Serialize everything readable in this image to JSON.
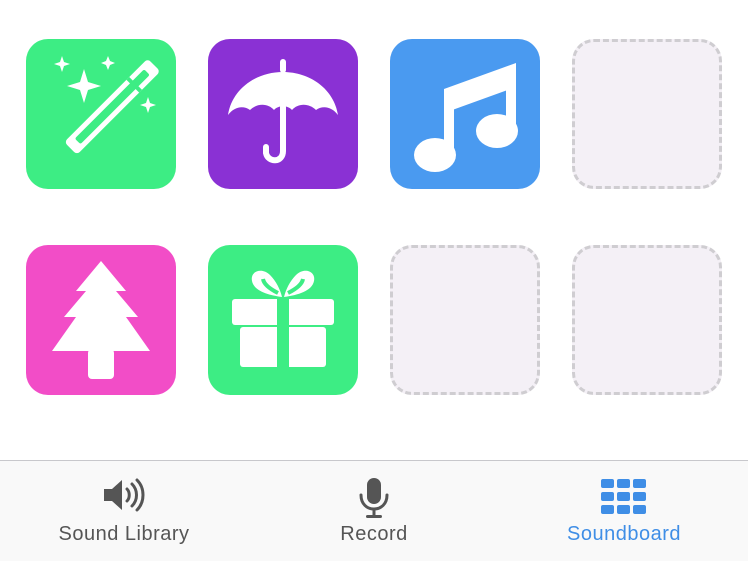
{
  "colors": {
    "tile_green": "#3ded84",
    "tile_purple": "#8a31d4",
    "tile_blue": "#4a9af0",
    "tile_pink": "#f24dc7",
    "empty_slot_bg": "#f4f0f6",
    "empty_slot_border": "#cfcdd1",
    "tab_inactive": "#555555",
    "tab_active": "#3f8ee6"
  },
  "soundboard": {
    "slots": [
      {
        "icon": "magic-wand-icon",
        "color": "#3ded84",
        "filled": true
      },
      {
        "icon": "umbrella-icon",
        "color": "#8a31d4",
        "filled": true
      },
      {
        "icon": "music-note-icon",
        "color": "#4a9af0",
        "filled": true
      },
      {
        "icon": null,
        "filled": false
      },
      {
        "icon": "christmas-tree-icon",
        "color": "#f24dc7",
        "filled": true
      },
      {
        "icon": "gift-icon",
        "color": "#3ded84",
        "filled": true
      },
      {
        "icon": null,
        "filled": false
      },
      {
        "icon": null,
        "filled": false
      }
    ]
  },
  "tabbar": {
    "tabs": [
      {
        "label": "Sound Library",
        "icon": "speaker-icon",
        "active": false
      },
      {
        "label": "Record",
        "icon": "microphone-icon",
        "active": false
      },
      {
        "label": "Soundboard",
        "icon": "grid-icon",
        "active": true
      }
    ]
  }
}
